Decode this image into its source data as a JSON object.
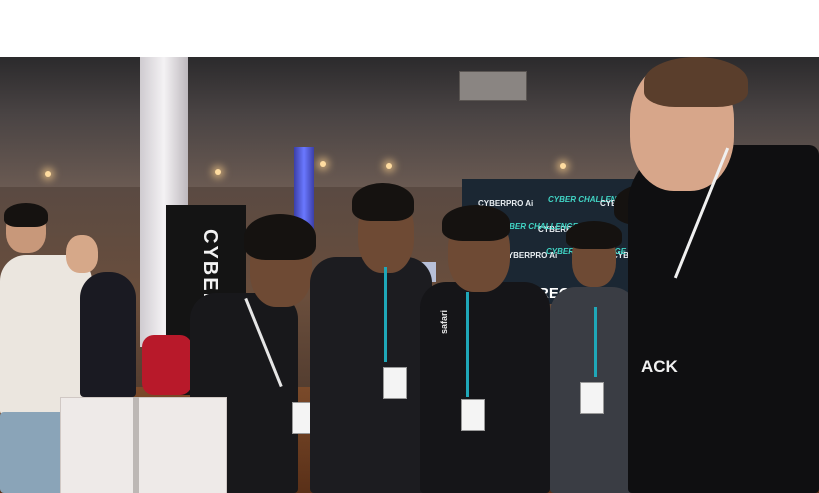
{
  "scene": {
    "description_alt": "",
    "banner_left_text": "CYBER",
    "backdrop": {
      "logos": [
        "CYBERPRO Ai",
        "CYBER CHALLENGE 2024",
        "CYBER",
        "CYBERPRO",
        "CYBER CHALLENGE",
        "CYBERPRO",
        "CYBERPRO Ai",
        "CYBER CHALLENGE",
        "CYBERPRO"
      ],
      "partial_word": "REC"
    },
    "badge_brand": "safari",
    "shirt_text": "ACK",
    "colors": {
      "backdrop": "#1b2733",
      "accent_teal": "#41d6c6",
      "lanyard": "#1fa7b8",
      "stage_light": "#6a78ff"
    }
  }
}
